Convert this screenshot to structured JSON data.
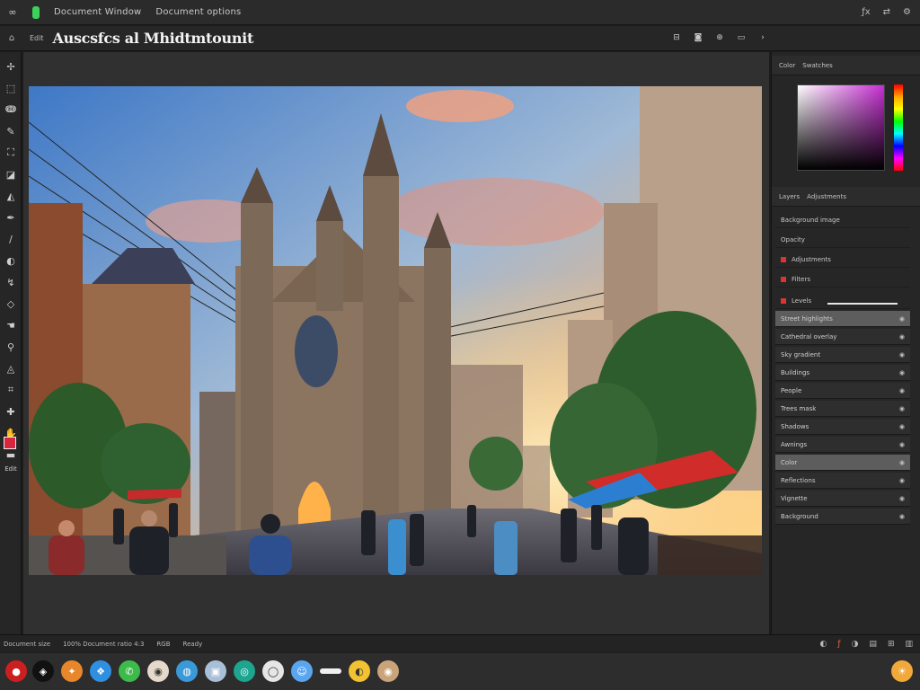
{
  "menubar": {
    "app_glyph": "∞",
    "menu_items": [
      "Document Window",
      "Document options"
    ],
    "right_icons": [
      "fx-icon",
      "swap-icon",
      "settings-icon"
    ]
  },
  "titlebar": {
    "home_icon": "⌂",
    "doc_tag": "Edit",
    "doc_title": "Auscsfcs al Mhidtmtounit"
  },
  "tools": [
    "move-tool-icon",
    "marquee-tool-icon",
    "lasso-tool-icon",
    "brush-tool-icon",
    "stamp-tool-icon",
    "eraser-tool-icon",
    "gradient-tool-icon",
    "pen-tool-icon",
    "dodge-tool-icon",
    "text-tool-icon",
    "path-tool-icon",
    "shape-tool-icon",
    "hand-tool-icon",
    "zoom-tool-icon",
    "eyedropper-tool-icon",
    "crop-tool-icon",
    "heal-tool-icon",
    "smudge-tool-icon",
    "blur-tool-icon"
  ],
  "tools_label": "Edit",
  "colors": {
    "foreground_swatch": "#d7263d",
    "accent": "#5d5d5d",
    "panel": "#262626"
  },
  "rightpanel": {
    "top_tabs": [
      "Color",
      "Swatches"
    ],
    "section_tabs": [
      "Layers",
      "Adjustments"
    ],
    "props": [
      {
        "label": "Background image",
        "mark": false
      },
      {
        "label": "Opacity",
        "mark": false
      },
      {
        "label": "Adjustments",
        "mark": true
      },
      {
        "label": "Filters",
        "mark": true
      },
      {
        "label": "Levels",
        "mark": true
      }
    ],
    "layers": [
      {
        "label": "Street highlights",
        "selected": true
      },
      {
        "label": "Cathedral overlay",
        "selected": false
      },
      {
        "label": "Sky gradient",
        "selected": false
      },
      {
        "label": "Buildings",
        "selected": false
      },
      {
        "label": "People",
        "selected": false
      },
      {
        "label": "Trees mask",
        "selected": false
      },
      {
        "label": "Shadows",
        "selected": false
      },
      {
        "label": "Awnings",
        "selected": false
      },
      {
        "label": "Color",
        "selected": true
      },
      {
        "label": "Reflections",
        "selected": false
      },
      {
        "label": "Vignette",
        "selected": false
      },
      {
        "label": "Background",
        "selected": false
      }
    ]
  },
  "statusbar": {
    "items": [
      "Document size",
      "100% Document ratio 4:3",
      "RGB",
      "Ready"
    ],
    "icons": [
      "mask-icon",
      "fx-small-icon",
      "adjust-icon",
      "folder-icon",
      "new-layer-icon",
      "trash-icon"
    ]
  },
  "dock": [
    {
      "name": "record-dock-icon",
      "color": "#cc2020",
      "glyph": "●"
    },
    {
      "name": "shield-dock-icon",
      "color": "#111111",
      "glyph": "◈"
    },
    {
      "name": "orange-app-dock-icon",
      "color": "#e8862b",
      "glyph": "✦"
    },
    {
      "name": "blue-app-dock-icon",
      "color": "#2f8fe0",
      "glyph": "❖"
    },
    {
      "name": "messages-dock-icon",
      "color": "#3dbb4a",
      "glyph": "✆"
    },
    {
      "name": "photos-dock-icon",
      "color": "#e6d9cc",
      "glyph": "◉"
    },
    {
      "name": "globe-dock-icon",
      "color": "#3a9ad9",
      "glyph": "◍"
    },
    {
      "name": "preview-dock-icon",
      "color": "#a9bfd8",
      "glyph": "▣"
    },
    {
      "name": "teal-app-dock-icon",
      "color": "#1ea58f",
      "glyph": "◎"
    },
    {
      "name": "white-app-dock-icon",
      "color": "#e6e6e6",
      "glyph": "◯"
    },
    {
      "name": "finder-dock-icon",
      "color": "#5aa5f0",
      "glyph": "☺"
    },
    {
      "name": "pill-dock-icon",
      "color": "#f0f0f0",
      "glyph": ""
    },
    {
      "name": "chrome-dock-icon",
      "color": "#f1c232",
      "glyph": "◐"
    },
    {
      "name": "camera-dock-icon",
      "color": "#c9a47a",
      "glyph": "◉"
    },
    {
      "name": "sun-dock-icon",
      "color": "#f1a93a",
      "glyph": "☀"
    }
  ]
}
